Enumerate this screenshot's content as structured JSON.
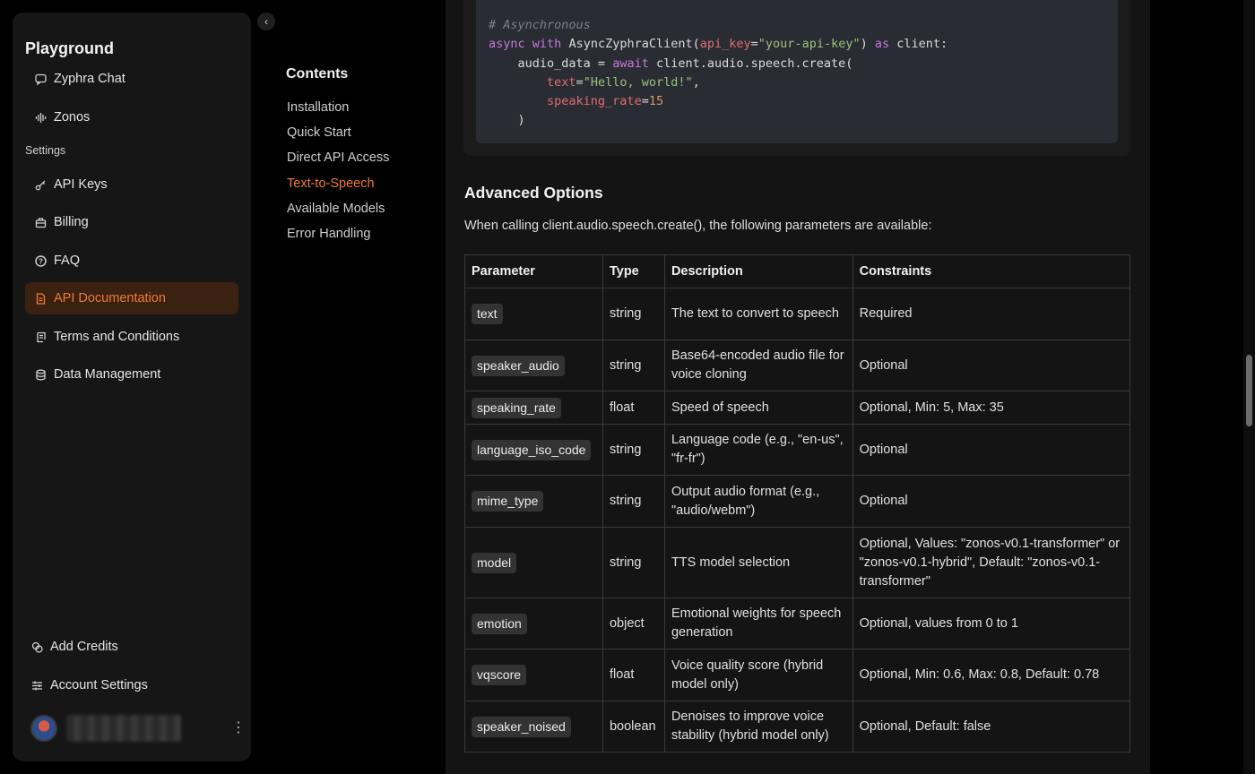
{
  "sidebar": {
    "brand": "Playground",
    "items_top": [
      {
        "label": "Zyphra Chat",
        "icon": "chat-bubble-icon"
      },
      {
        "label": "Zonos",
        "icon": "audio-wave-icon"
      }
    ],
    "settings_label": "Settings",
    "items_settings": [
      {
        "label": "API Keys",
        "icon": "key-icon"
      },
      {
        "label": "Billing",
        "icon": "briefcase-icon"
      },
      {
        "label": "FAQ",
        "icon": "question-circle-icon"
      },
      {
        "label": "API Documentation",
        "icon": "document-icon",
        "active": true
      },
      {
        "label": "Terms and Conditions",
        "icon": "scroll-icon"
      },
      {
        "label": "Data Management",
        "icon": "database-icon"
      }
    ],
    "add_credits": "Add Credits",
    "account_settings": "Account Settings"
  },
  "toc": {
    "title": "Contents",
    "items": [
      "Installation",
      "Quick Start",
      "Direct API Access",
      "Text-to-Speech",
      "Available Models",
      "Error Handling"
    ],
    "active_index": 3
  },
  "code": {
    "comment": "# Asynchronous",
    "kw_async": "async",
    "kw_with": "with",
    "client_class": "AsyncZyphraClient(",
    "arg_key": "api_key",
    "eq": "=",
    "api_key_value": "\"your-api-key\"",
    "close_as": ")",
    "kw_as": "as",
    "client_var": "client:",
    "line2_var": "audio_data = ",
    "kw_await": "await",
    "line2_call": "client.audio.speech.create(",
    "arg_text": "text",
    "text_value": "\"Hello, world!\"",
    "comma": ",",
    "arg_rate": "speaking_rate",
    "rate_value": "15",
    "close_paren": ")"
  },
  "advanced": {
    "title": "Advanced Options",
    "description": "When calling client.audio.speech.create(), the following parameters are available:",
    "headers": [
      "Parameter",
      "Type",
      "Description",
      "Constraints"
    ],
    "rows": [
      {
        "param": "text",
        "type": "string",
        "desc": "The text to convert to speech",
        "constraints": "Required"
      },
      {
        "param": "speaker_audio",
        "type": "string",
        "desc": "Base64-encoded audio file for voice cloning",
        "constraints": "Optional"
      },
      {
        "param": "speaking_rate",
        "type": "float",
        "desc": "Speed of speech",
        "constraints": "Optional, Min: 5, Max: 35"
      },
      {
        "param": "language_iso_code",
        "type": "string",
        "desc": "Language code (e.g., \"en-us\", \"fr-fr\")",
        "constraints": "Optional"
      },
      {
        "param": "mime_type",
        "type": "string",
        "desc": "Output audio format (e.g., \"audio/webm\")",
        "constraints": "Optional"
      },
      {
        "param": "model",
        "type": "string",
        "desc": "TTS model selection",
        "constraints": "Optional, Values: \"zonos-v0.1-transformer\" or \"zonos-v0.1-hybrid\", Default: \"zonos-v0.1-transformer\""
      },
      {
        "param": "emotion",
        "type": "object",
        "desc": "Emotional weights for speech generation",
        "constraints": "Optional, values from 0 to 1"
      },
      {
        "param": "vqscore",
        "type": "float",
        "desc": "Voice quality score (hybrid model only)",
        "constraints": "Optional, Min: 0.6, Max: 0.8, Default: 0.78"
      },
      {
        "param": "speaker_noised",
        "type": "boolean",
        "desc": "Denoises to improve voice stability (hybrid model only)",
        "constraints": "Optional, Default: false"
      }
    ]
  },
  "colors": {
    "accent": "#f07a35",
    "active_bg": "#3a2112"
  }
}
